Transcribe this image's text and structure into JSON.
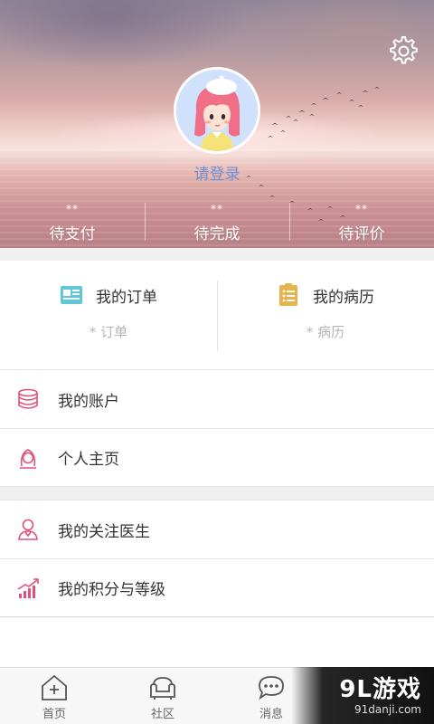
{
  "header": {
    "login_text": "请登录",
    "stats": [
      {
        "count": "**",
        "label": "待支付"
      },
      {
        "count": "**",
        "label": "待完成"
      },
      {
        "count": "**",
        "label": "待评价"
      }
    ]
  },
  "quick": [
    {
      "title": "我的订单",
      "sub": "* 订单",
      "icon": "order-card-icon",
      "color": "#5fc7d6"
    },
    {
      "title": "我的病历",
      "sub": "* 病历",
      "icon": "medical-record-icon",
      "color": "#e6b34d"
    }
  ],
  "menu_group_1": [
    {
      "label": "我的账户",
      "icon": "coins-stack-icon"
    },
    {
      "label": "个人主页",
      "icon": "person-head-icon"
    }
  ],
  "menu_group_2": [
    {
      "label": "我的关注医生",
      "icon": "doctor-icon"
    },
    {
      "label": "我的积分与等级",
      "icon": "level-chart-icon"
    }
  ],
  "tabs": [
    {
      "label": "首页",
      "icon": "home-plus-icon"
    },
    {
      "label": "社区",
      "icon": "community-sofa-icon"
    },
    {
      "label": "消息",
      "icon": "message-bubble-icon"
    }
  ],
  "watermark": {
    "main": "9L游戏",
    "sub": "91danji.com"
  },
  "colors": {
    "accent_pink": "#e0507a",
    "login_blue": "#6e8fd2"
  }
}
